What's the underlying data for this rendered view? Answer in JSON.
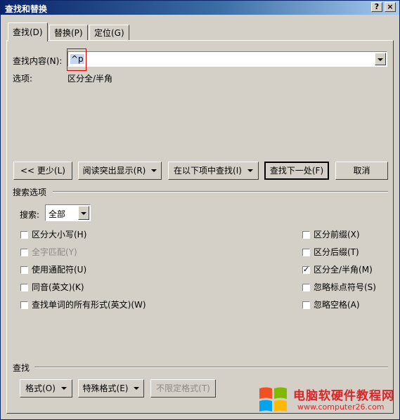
{
  "window": {
    "title": "查找和替换",
    "help_btn": "?",
    "close_btn": "×"
  },
  "tabs": [
    {
      "label": "查找(D)"
    },
    {
      "label": "替换(P)"
    },
    {
      "label": "定位(G)"
    }
  ],
  "find": {
    "label": "查找内容(N):",
    "value": "^p",
    "options_label": "选项:",
    "options_value": "区分全/半角"
  },
  "buttons": {
    "less": "<< 更少(L)",
    "highlight": "阅读突出显示(R)",
    "find_in": "在以下项中查找(I)",
    "find_next": "查找下一处(F)",
    "cancel": "取消"
  },
  "search_options": {
    "header": "搜索选项",
    "search_label": "搜索:",
    "search_value": "全部"
  },
  "checkboxes_left": [
    {
      "label": "区分大小写(H)",
      "checked": false,
      "disabled": false
    },
    {
      "label": "全字匹配(Y)",
      "checked": false,
      "disabled": true
    },
    {
      "label": "使用通配符(U)",
      "checked": false,
      "disabled": false
    },
    {
      "label": "同音(英文)(K)",
      "checked": false,
      "disabled": false
    },
    {
      "label": "查找单词的所有形式(英文)(W)",
      "checked": false,
      "disabled": false
    }
  ],
  "checkboxes_right": [
    {
      "label": "区分前缀(X)",
      "checked": false,
      "disabled": false
    },
    {
      "label": "区分后缀(T)",
      "checked": false,
      "disabled": false
    },
    {
      "label": "区分全/半角(M)",
      "checked": true,
      "disabled": false
    },
    {
      "label": "忽略标点符号(S)",
      "checked": false,
      "disabled": false
    },
    {
      "label": "忽略空格(A)",
      "checked": false,
      "disabled": false
    }
  ],
  "find_section": {
    "header": "查找",
    "format": "格式(O)",
    "special": "特殊格式(E)",
    "no_format": "不限定格式(T)"
  },
  "watermark": {
    "text_cn": "电脑软硬件教程网",
    "text_url": "www.computer26.com"
  },
  "colors": {
    "title_start": "#0a246a",
    "title_end": "#a6caf0",
    "dialog_bg": "#d4d0c8",
    "watermark_red": "#d9262b",
    "win_red": "#f25022",
    "win_green": "#7fba00",
    "win_blue": "#00a4ef",
    "win_yellow": "#ffb900"
  }
}
